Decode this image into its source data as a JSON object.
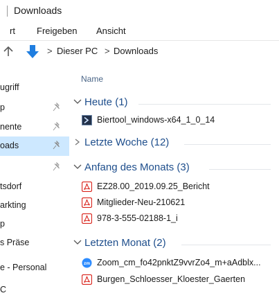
{
  "window": {
    "title": "Downloads"
  },
  "ribbon": {
    "tabs": [
      "rt",
      "Freigeben",
      "Ansicht"
    ]
  },
  "address": {
    "breadcrumb": [
      "Dieser PC",
      "Downloads"
    ]
  },
  "sidebar": {
    "items": [
      {
        "label": "ugriff",
        "pinned": false,
        "active": false
      },
      {
        "label": "p",
        "pinned": true,
        "active": false
      },
      {
        "label": "nente",
        "pinned": true,
        "active": false
      },
      {
        "label": "oads",
        "pinned": true,
        "active": true
      },
      {
        "label": "",
        "pinned": true,
        "active": false
      },
      {
        "label": "tsdorf",
        "pinned": false,
        "active": false
      },
      {
        "label": "arkting",
        "pinned": false,
        "active": false
      },
      {
        "label": "p",
        "pinned": false,
        "active": false
      },
      {
        "label": "s Präse",
        "pinned": false,
        "active": false
      },
      {
        "label": "e - Personal",
        "pinned": false,
        "active": false
      },
      {
        "label": "C",
        "pinned": false,
        "active": false
      }
    ]
  },
  "file_list": {
    "column_header": "Name",
    "groups": [
      {
        "title": "Heute (1)",
        "expanded": true,
        "files": [
          {
            "name": "Biertool_windows-x64_1_0_14",
            "icon": "app-icon"
          }
        ]
      },
      {
        "title": "Letzte Woche (12)",
        "expanded": false,
        "files": []
      },
      {
        "title": "Anfang des Monats (3)",
        "expanded": true,
        "files": [
          {
            "name": "EZ28.00_2019.09.25_Bericht",
            "icon": "pdf-icon"
          },
          {
            "name": "Mitglieder-Neu-210621",
            "icon": "pdf-icon"
          },
          {
            "name": "978-3-555-02188-1_i",
            "icon": "pdf-icon"
          }
        ]
      },
      {
        "title": "Letzten Monat (2)",
        "expanded": true,
        "files": [
          {
            "name": "Zoom_cm_fo42pnktZ9vvrZo4_m+aAdblx...",
            "icon": "zoom-icon"
          },
          {
            "name": "Burgen_Schloesser_Kloester_Gaerten",
            "icon": "pdf-icon"
          }
        ]
      }
    ]
  },
  "colors": {
    "accent": "#1e4e8c",
    "selection": "#cde8ff",
    "pdf_red": "#d9241c",
    "zoom_blue": "#2d8cff"
  }
}
